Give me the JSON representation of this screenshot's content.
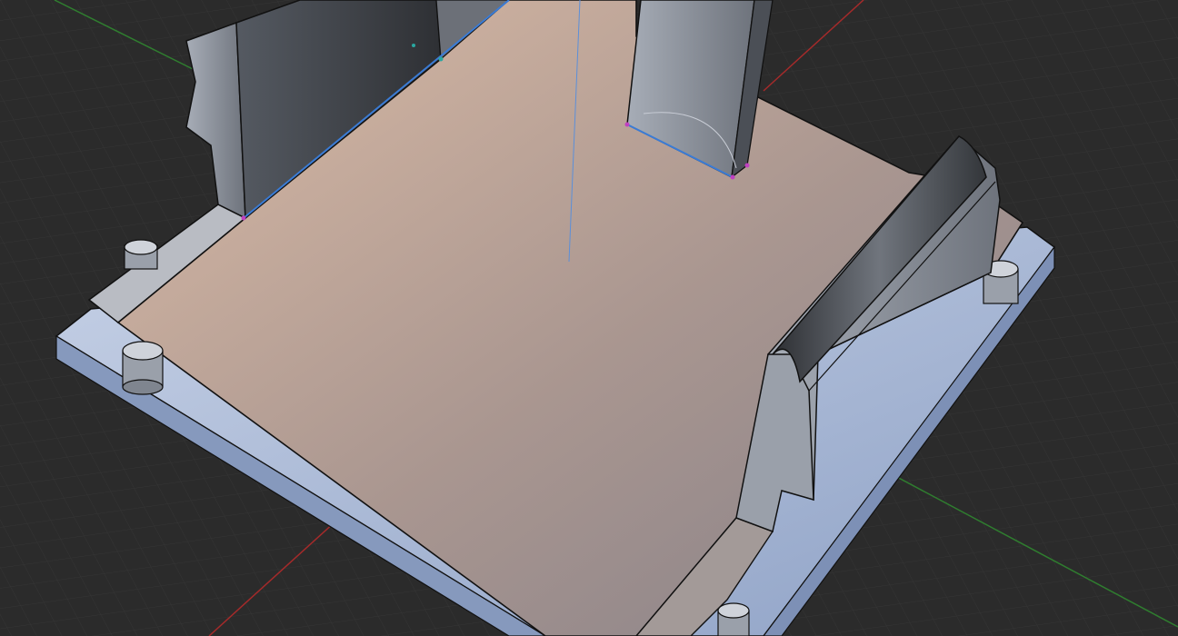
{
  "viewport": {
    "background": "#2b2b2b",
    "grid_minor_color": "#353535",
    "grid_major_color": "#3e3e3e",
    "axis_x_color": "#a52a2a",
    "axis_y_color": "#2f7d2f"
  },
  "model": {
    "top_face_light": "#d7b6a0",
    "top_face_dark": "#8e8584",
    "side_face_color": "#8a8f98",
    "base_rim_color": "#9fb0cc",
    "edge_color": "#111111",
    "selected_edge_color": "#3a7bd5",
    "vertex_color": "#c040c0"
  }
}
